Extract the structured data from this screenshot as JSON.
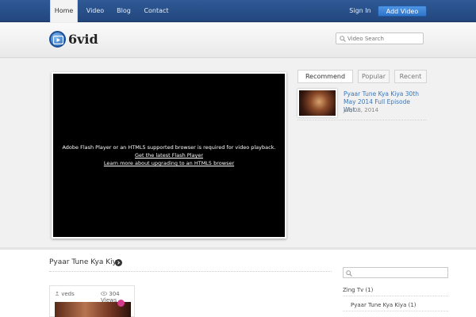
{
  "nav": {
    "items": [
      {
        "label": "Home",
        "active": true
      },
      {
        "label": "Video",
        "active": false
      },
      {
        "label": "Blog",
        "active": false
      },
      {
        "label": "Contact",
        "active": false
      }
    ],
    "signin_label": "Sign In",
    "add_video_label": "Add Video"
  },
  "header": {
    "logo_text": "6vid",
    "search_placeholder": "Video Search"
  },
  "player": {
    "message": "Adobe Flash Player or an HTML5 supported browser is required for video playback.",
    "link1": "Get the latest Flash Player",
    "link2": "Learn more about upgrading to an HTML5 browser"
  },
  "sidebar_tabs": {
    "items": [
      {
        "label": "Recommend",
        "active": true
      },
      {
        "label": "Popular",
        "active": false
      },
      {
        "label": "Recent",
        "active": false
      }
    ]
  },
  "recommended": {
    "title": "Pyaar Tune Kya Kiya 30th May 2014 Full Episode Wat...",
    "date": "Jul, 08, 2014"
  },
  "section": {
    "title": "Pyaar Tune Kya Kiya"
  },
  "video_card": {
    "author": "veds",
    "views": "304 Views"
  },
  "categories": {
    "category": "Zing Tv (1)",
    "subcategory": "Pyaar Tune Kya Kiya (1)"
  },
  "colors": {
    "nav_bg": "#2f5a96",
    "accent_button": "#3f85d8",
    "link": "#3b76b8"
  }
}
